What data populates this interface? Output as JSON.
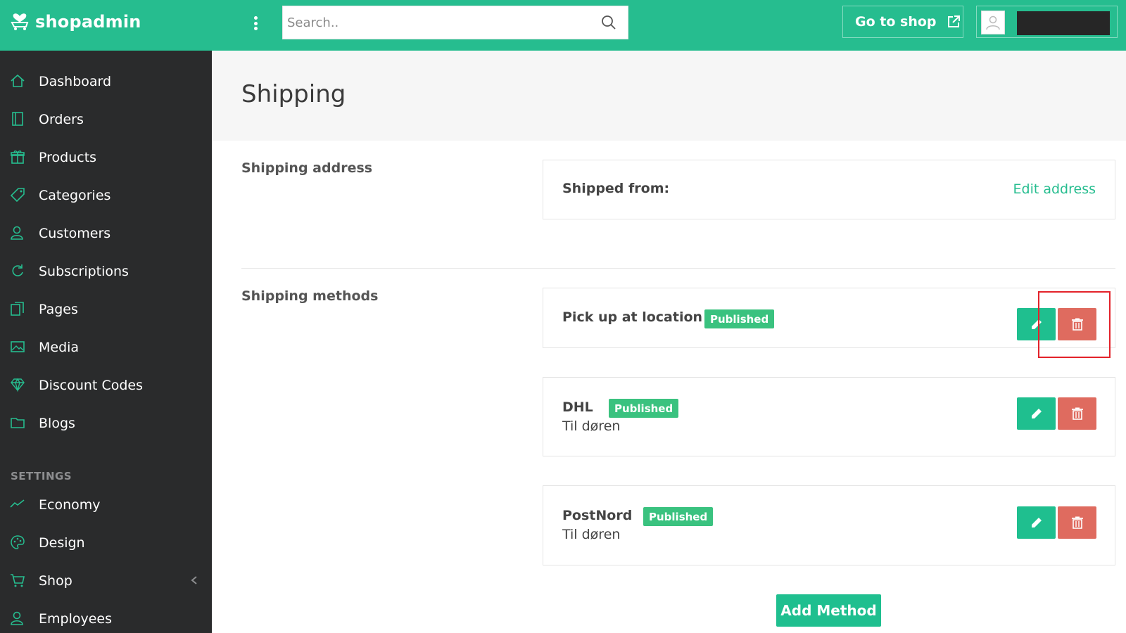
{
  "app": {
    "name": "shopadmin",
    "accent_color": "#26bd8f",
    "sidebar_color": "#2a2b2c",
    "delete_color": "#df6b5f",
    "badge_color": "#3ac27f",
    "highlight_color": "#e3222a"
  },
  "topbar": {
    "search_placeholder": "Search..",
    "search_value": "",
    "go_to_shop_label": "Go to shop",
    "user_name": "",
    "icons": [
      "cart-heart-logo-icon",
      "kebab-menu-icon",
      "search-icon",
      "external-link-icon",
      "user-avatar-icon"
    ]
  },
  "sidebar": {
    "items": [
      {
        "label": "Dashboard",
        "icon": "home-icon"
      },
      {
        "label": "Orders",
        "icon": "orders-icon"
      },
      {
        "label": "Products",
        "icon": "gift-icon"
      },
      {
        "label": "Categories",
        "icon": "tag-icon"
      },
      {
        "label": "Customers",
        "icon": "customers-icon"
      },
      {
        "label": "Subscriptions",
        "icon": "refresh-icon"
      },
      {
        "label": "Pages",
        "icon": "pages-icon"
      },
      {
        "label": "Media",
        "icon": "image-icon"
      },
      {
        "label": "Discount Codes",
        "icon": "diamond-icon"
      },
      {
        "label": "Blogs",
        "icon": "folder-icon"
      }
    ],
    "settings_heading": "SETTINGS",
    "settings_items": [
      {
        "label": "Economy",
        "icon": "trend-line-icon"
      },
      {
        "label": "Design",
        "icon": "palette-icon"
      },
      {
        "label": "Shop",
        "icon": "cart-icon",
        "has_chevron": true
      },
      {
        "label": "Employees",
        "icon": "employees-icon"
      }
    ]
  },
  "main": {
    "page_title": "Shipping",
    "shipping_address": {
      "section_label": "Shipping address",
      "shipped_from_label": "Shipped from:",
      "edit_link": "Edit address"
    },
    "shipping_methods": {
      "section_label": "Shipping methods",
      "methods": [
        {
          "name": "Pick up at location",
          "status": "Published",
          "subtitle": ""
        },
        {
          "name": "DHL",
          "status": "Published",
          "subtitle": "Til døren"
        },
        {
          "name": "PostNord",
          "status": "Published",
          "subtitle": "Til døren"
        }
      ],
      "add_button": "Add Method"
    }
  }
}
